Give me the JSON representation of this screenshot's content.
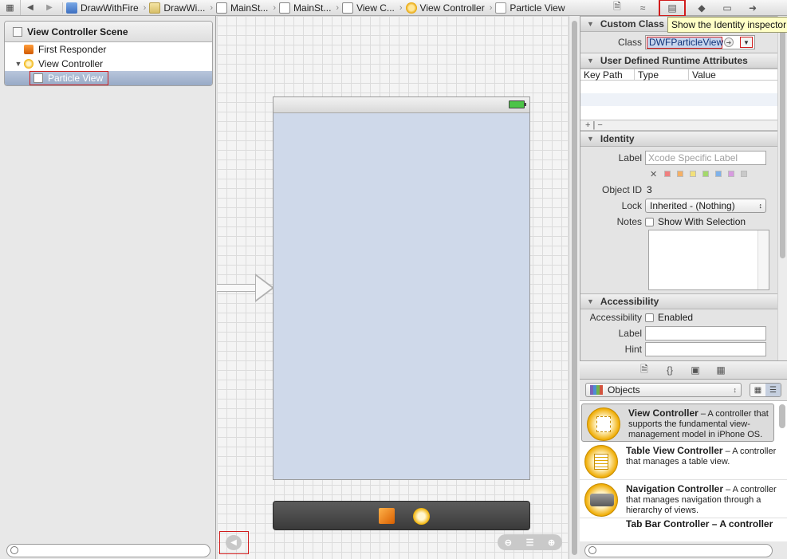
{
  "jumpbar": {
    "crumbs": [
      {
        "label": "DrawWithFire",
        "icon": "project-icon"
      },
      {
        "label": "DrawWi...",
        "icon": "folder-icon"
      },
      {
        "label": "MainSt...",
        "icon": "storyboard-icon"
      },
      {
        "label": "MainSt...",
        "icon": "storyboard-icon"
      },
      {
        "label": "View C...",
        "icon": "storyboard-icon"
      },
      {
        "label": "View Controller",
        "icon": "view-controller-icon"
      },
      {
        "label": "Particle View",
        "icon": "view-icon"
      }
    ]
  },
  "tooltip": "Show the Identity inspector",
  "outline": {
    "scene_title": "View Controller Scene",
    "items": [
      "First Responder",
      "View Controller",
      "Particle View"
    ]
  },
  "inspector": {
    "custom_class": {
      "title": "Custom Class",
      "class_label": "Class",
      "class_value": "DWFParticleView"
    },
    "runtime_attributes": {
      "title": "User Defined Runtime Attributes",
      "columns": [
        "Key Path",
        "Type",
        "Value"
      ],
      "add_remove": "+ | −"
    },
    "identity": {
      "title": "Identity",
      "label_label": "Label",
      "label_placeholder": "Xcode Specific Label",
      "object_id_label": "Object ID",
      "object_id_value": "3",
      "lock_label": "Lock",
      "lock_value": "Inherited - (Nothing)",
      "notes_label": "Notes",
      "notes_checkbox": "Show With Selection"
    },
    "accessibility": {
      "title": "Accessibility",
      "accessibility_label": "Accessibility",
      "enabled_label": "Enabled",
      "label_label": "Label",
      "hint_label": "Hint"
    },
    "label_colors": [
      "#f08080",
      "#f5b065",
      "#f2e07a",
      "#a4d96c",
      "#7fb2ea",
      "#d89be0",
      "#c9c9c9"
    ]
  },
  "library": {
    "filter": "Objects",
    "items": [
      {
        "name": "View Controller",
        "desc": " – A controller that supports the fundamental view-management model in iPhone OS."
      },
      {
        "name": "Table View Controller",
        "desc": " – A controller that manages a table view."
      },
      {
        "name": "Navigation Controller",
        "desc": " – A controller that manages navigation through a hierarchy of views."
      }
    ],
    "partial_item": "Tab Bar Controller – A controller"
  }
}
